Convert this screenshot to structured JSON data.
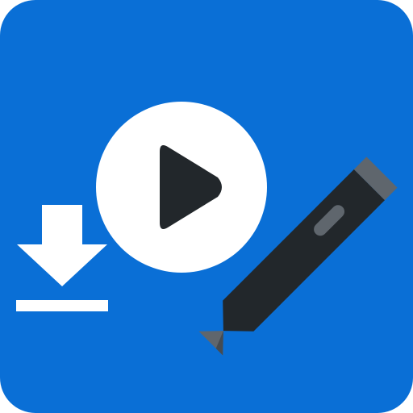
{
  "app_icon": {
    "icons": {
      "background": "rounded-square-background",
      "download": "download-icon",
      "play": "play-icon",
      "pen": "pen-icon"
    },
    "colors": {
      "background": "#0A6FD6",
      "white": "#FFFFFF",
      "dark": "#22272B",
      "gray": "#5F666D"
    }
  }
}
